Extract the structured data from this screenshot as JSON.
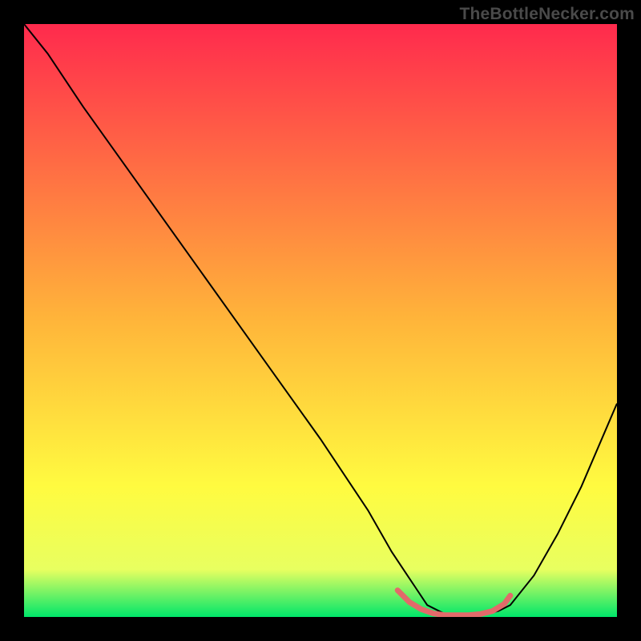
{
  "watermark": "TheBottleNecker.com",
  "chart_data": {
    "type": "line",
    "title": "",
    "xlabel": "",
    "ylabel": "",
    "xlim": [
      0,
      100
    ],
    "ylim": [
      0,
      100
    ],
    "grid": false,
    "gradient_stops": [
      {
        "offset": 0.0,
        "color": "#ff2a4d"
      },
      {
        "offset": 0.5,
        "color": "#ffb53a"
      },
      {
        "offset": 0.78,
        "color": "#fffb40"
      },
      {
        "offset": 0.92,
        "color": "#e8ff60"
      },
      {
        "offset": 1.0,
        "color": "#00e66a"
      }
    ],
    "series": [
      {
        "name": "bottleneck-curve",
        "color": "#000000",
        "width": 2,
        "x": [
          0,
          4,
          6,
          10,
          20,
          30,
          40,
          50,
          58,
          62,
          66,
          68,
          72,
          76,
          80,
          82,
          86,
          90,
          94,
          100
        ],
        "y": [
          100,
          95,
          92,
          86,
          72,
          58,
          44,
          30,
          18,
          11,
          5,
          2,
          0,
          0,
          1,
          2,
          7,
          14,
          22,
          36
        ]
      },
      {
        "name": "bottleneck-zone-marker",
        "color": "#e26a6a",
        "width": 7,
        "x": [
          63,
          65,
          67,
          69,
          71,
          73,
          75,
          77,
          79,
          81,
          82
        ],
        "y": [
          4.5,
          2.5,
          1.3,
          0.6,
          0.3,
          0.3,
          0.3,
          0.5,
          1.0,
          2.2,
          3.6
        ]
      }
    ]
  }
}
